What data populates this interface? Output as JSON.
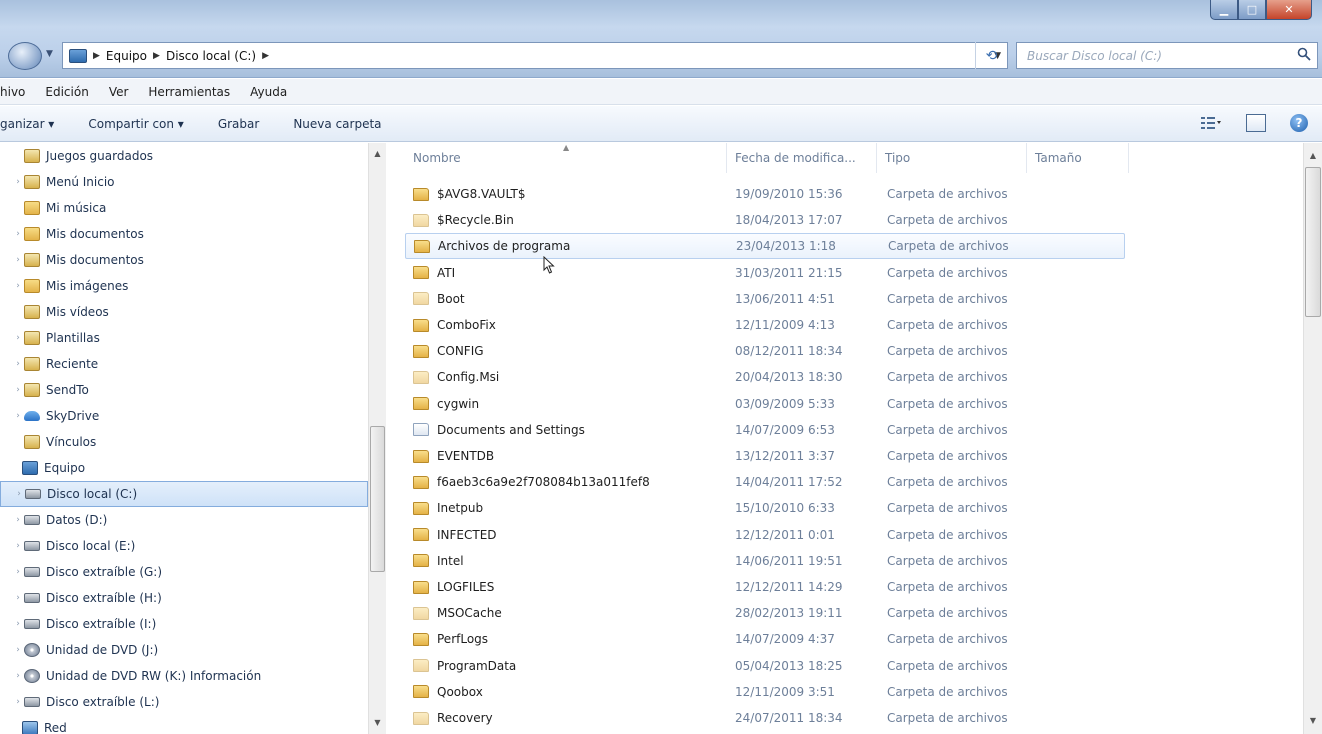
{
  "address": {
    "crumbs": [
      "Equipo",
      "Disco local (C:)"
    ],
    "search_placeholder": "Buscar Disco local (C:)"
  },
  "menu": [
    "Archivo",
    "Edición",
    "Ver",
    "Herramientas",
    "Ayuda"
  ],
  "menu_visible": [
    "hivo",
    "Edición",
    "Ver",
    "Herramientas",
    "Ayuda"
  ],
  "commands": {
    "organize": "ganizar ▾",
    "share": "Compartir con ▾",
    "burn": "Grabar",
    "new_folder": "Nueva carpeta"
  },
  "nav": {
    "items": [
      {
        "label": "Juegos guardados",
        "icon": "special",
        "exp": ""
      },
      {
        "label": "Menú Inicio",
        "icon": "special",
        "exp": "›"
      },
      {
        "label": "Mi música",
        "icon": "music",
        "exp": ""
      },
      {
        "label": "Mis documentos",
        "icon": "folder",
        "exp": "›"
      },
      {
        "label": "Mis documentos",
        "icon": "special",
        "exp": "›"
      },
      {
        "label": "Mis imágenes",
        "icon": "folder",
        "exp": "›"
      },
      {
        "label": "Mis vídeos",
        "icon": "special",
        "exp": ""
      },
      {
        "label": "Plantillas",
        "icon": "special",
        "exp": "›"
      },
      {
        "label": "Reciente",
        "icon": "special",
        "exp": "›"
      },
      {
        "label": "SendTo",
        "icon": "special",
        "exp": "›"
      },
      {
        "label": "SkyDrive",
        "icon": "cloud",
        "exp": "›"
      },
      {
        "label": "Vínculos",
        "icon": "special",
        "exp": ""
      },
      {
        "label": "Equipo",
        "icon": "pc",
        "exp": ""
      },
      {
        "label": "Disco local (C:)",
        "icon": "drive",
        "exp": "›"
      },
      {
        "label": "Datos (D:)",
        "icon": "drive",
        "exp": "›"
      },
      {
        "label": "Disco local (E:)",
        "icon": "drive",
        "exp": "›"
      },
      {
        "label": "Disco extraíble (G:)",
        "icon": "drive",
        "exp": "›"
      },
      {
        "label": "Disco extraíble (H:)",
        "icon": "drive",
        "exp": "›"
      },
      {
        "label": "Disco extraíble (I:)",
        "icon": "drive",
        "exp": "›"
      },
      {
        "label": "Unidad de DVD (J:)",
        "icon": "dvd",
        "exp": "›"
      },
      {
        "label": "Unidad de DVD RW (K:) Información",
        "icon": "dvd",
        "exp": "›"
      },
      {
        "label": "Disco extraíble (L:)",
        "icon": "drive",
        "exp": "›"
      },
      {
        "label": "Red",
        "icon": "net",
        "exp": ""
      }
    ],
    "selected_index": 13
  },
  "columns": [
    "Nombre",
    "Fecha de modifica...",
    "Tipo",
    "Tamaño"
  ],
  "files": [
    {
      "name": "$AVG8.VAULT$",
      "date": "19/09/2010 15:36",
      "type": "Carpeta de archivos",
      "kind": "folder"
    },
    {
      "name": "$Recycle.Bin",
      "date": "18/04/2013 17:07",
      "type": "Carpeta de archivos",
      "kind": "hidden"
    },
    {
      "name": "Archivos de programa",
      "date": "23/04/2013 1:18",
      "type": "Carpeta de archivos",
      "kind": "folder"
    },
    {
      "name": "ATI",
      "date": "31/03/2011 21:15",
      "type": "Carpeta de archivos",
      "kind": "folder"
    },
    {
      "name": "Boot",
      "date": "13/06/2011 4:51",
      "type": "Carpeta de archivos",
      "kind": "hidden"
    },
    {
      "name": "ComboFix",
      "date": "12/11/2009 4:13",
      "type": "Carpeta de archivos",
      "kind": "folder"
    },
    {
      "name": "CONFIG",
      "date": "08/12/2011 18:34",
      "type": "Carpeta de archivos",
      "kind": "folder"
    },
    {
      "name": "Config.Msi",
      "date": "20/04/2013 18:30",
      "type": "Carpeta de archivos",
      "kind": "hidden"
    },
    {
      "name": "cygwin",
      "date": "03/09/2009 5:33",
      "type": "Carpeta de archivos",
      "kind": "folder"
    },
    {
      "name": "Documents and Settings",
      "date": "14/07/2009 6:53",
      "type": "Carpeta de archivos",
      "kind": "link"
    },
    {
      "name": "EVENTDB",
      "date": "13/12/2011 3:37",
      "type": "Carpeta de archivos",
      "kind": "folder"
    },
    {
      "name": "f6aeb3c6a9e2f708084b13a011fef8",
      "date": "14/04/2011 17:52",
      "type": "Carpeta de archivos",
      "kind": "folder"
    },
    {
      "name": "Inetpub",
      "date": "15/10/2010 6:33",
      "type": "Carpeta de archivos",
      "kind": "folder"
    },
    {
      "name": "INFECTED",
      "date": "12/12/2011 0:01",
      "type": "Carpeta de archivos",
      "kind": "folder"
    },
    {
      "name": "Intel",
      "date": "14/06/2011 19:51",
      "type": "Carpeta de archivos",
      "kind": "folder"
    },
    {
      "name": "LOGFILES",
      "date": "12/12/2011 14:29",
      "type": "Carpeta de archivos",
      "kind": "folder"
    },
    {
      "name": "MSOCache",
      "date": "28/02/2013 19:11",
      "type": "Carpeta de archivos",
      "kind": "hidden"
    },
    {
      "name": "PerfLogs",
      "date": "14/07/2009 4:37",
      "type": "Carpeta de archivos",
      "kind": "folder"
    },
    {
      "name": "ProgramData",
      "date": "05/04/2013 18:25",
      "type": "Carpeta de archivos",
      "kind": "hidden"
    },
    {
      "name": "Qoobox",
      "date": "12/11/2009 3:51",
      "type": "Carpeta de archivos",
      "kind": "folder"
    },
    {
      "name": "Recovery",
      "date": "24/07/2011 18:34",
      "type": "Carpeta de archivos",
      "kind": "hidden"
    }
  ],
  "hover_index": 2
}
